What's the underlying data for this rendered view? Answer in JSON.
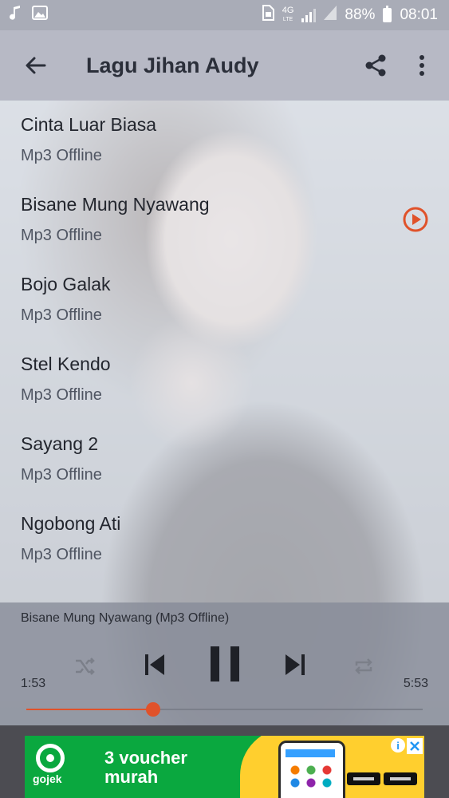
{
  "status_bar": {
    "network_top": "4G",
    "network_bottom": "LTE",
    "battery": "88%",
    "time": "08:01",
    "icons": [
      "music-note-icon",
      "image-icon",
      "sim-icon",
      "signal-icon",
      "battery-icon"
    ]
  },
  "app_bar": {
    "title": "Lagu Jihan Audy",
    "back_icon": "arrow-back-icon",
    "share_icon": "share-icon",
    "more_icon": "more-vert-icon"
  },
  "songs": [
    {
      "title": "Cinta Luar Biasa",
      "subtitle": "Mp3 Offline",
      "playing": false
    },
    {
      "title": "Bisane Mung Nyawang",
      "subtitle": "Mp3 Offline",
      "playing": true
    },
    {
      "title": "Bojo Galak",
      "subtitle": "Mp3 Offline",
      "playing": false
    },
    {
      "title": "Stel Kendo",
      "subtitle": "Mp3 Offline",
      "playing": false
    },
    {
      "title": "Sayang 2",
      "subtitle": "Mp3 Offline",
      "playing": false
    },
    {
      "title": "Ngobong Ati",
      "subtitle": "Mp3 Offline",
      "playing": false
    }
  ],
  "player": {
    "now_playing": "Bisane Mung Nyawang (Mp3 Offline)",
    "current_time": "1:53",
    "total_time": "5:53",
    "progress_fraction": 0.32,
    "controls": [
      "shuffle-icon",
      "skip-previous-icon",
      "pause-icon",
      "skip-next-icon",
      "repeat-icon"
    ]
  },
  "colors": {
    "accent": "#e0522a",
    "ad_green": "#0aa83f",
    "ad_yellow": "#ffcf2e"
  },
  "ad": {
    "brand": "gojek",
    "headline_line1": "3 voucher",
    "headline_line2": "murah",
    "info_label": "i"
  }
}
